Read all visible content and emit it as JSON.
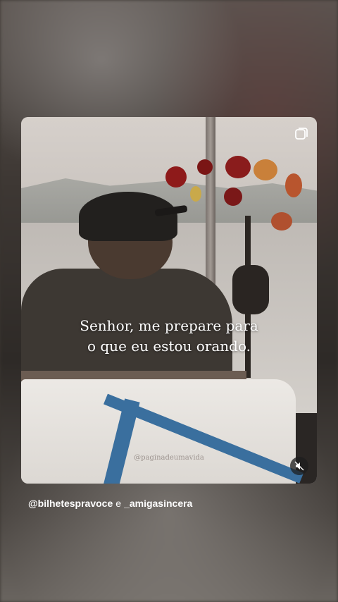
{
  "post": {
    "quote_line1": "Senhor, me prepare para",
    "quote_line2": "o que eu estou orando.",
    "watermark": "@paginadeumavida",
    "multi_image_icon": "carousel-icon",
    "audio_icon": "speaker-muted-icon"
  },
  "credit": {
    "user1": "@bilhetespravoce",
    "conjunction": "e",
    "user2": "_amigasincera"
  },
  "colors": {
    "strap": "#3a6f9e",
    "text": "#ffffff"
  }
}
